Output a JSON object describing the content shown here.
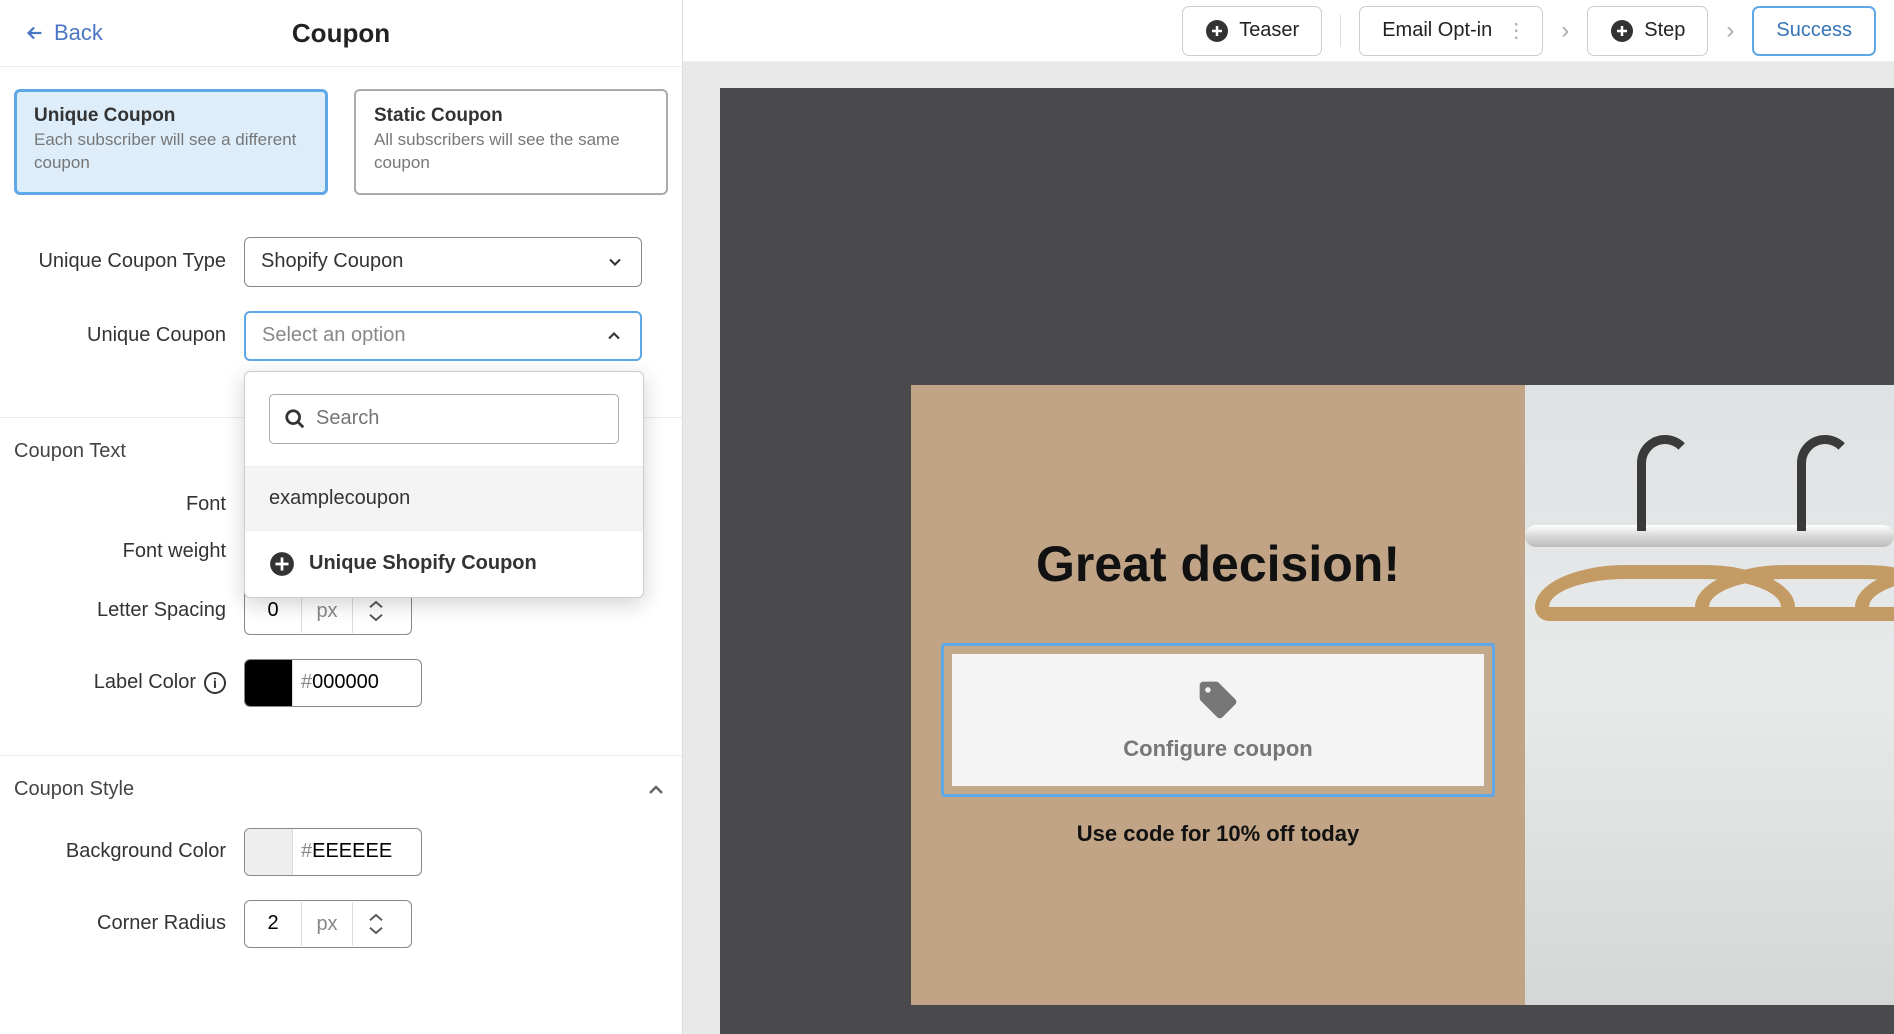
{
  "header": {
    "back": "Back",
    "title": "Coupon"
  },
  "coupon_types": {
    "unique": {
      "title": "Unique Coupon",
      "desc": "Each subscriber will see a different coupon"
    },
    "static": {
      "title": "Static Coupon",
      "desc": "All subscribers will see the same coupon"
    }
  },
  "fields": {
    "unique_type_label": "Unique Coupon Type",
    "unique_type_value": "Shopify Coupon",
    "unique_coupon_label": "Unique Coupon",
    "unique_coupon_placeholder": "Select an option"
  },
  "dropdown": {
    "search_placeholder": "Search",
    "items": [
      "examplecoupon"
    ],
    "add_label": "Unique Shopify Coupon"
  },
  "coupon_text_section": {
    "title": "Coupon Text",
    "font_label": "Font",
    "font_weight_label": "Font weight",
    "letter_spacing_label": "Letter Spacing",
    "letter_spacing_value": "0",
    "letter_spacing_unit": "px",
    "label_color_label": "Label Color",
    "label_color_value": "000000",
    "label_color_hex": "#000000"
  },
  "coupon_style_section": {
    "title": "Coupon Style",
    "bg_color_label": "Background Color",
    "bg_color_value": "EEEEEE",
    "bg_color_hex": "#EEEEEE",
    "corner_radius_label": "Corner Radius",
    "corner_radius_value": "2",
    "corner_radius_unit": "px"
  },
  "topbar": {
    "teaser": "Teaser",
    "email_optin": "Email Opt-in",
    "step": "Step",
    "success": "Success"
  },
  "preview": {
    "title": "Great decision!",
    "coupon_text": "Configure coupon",
    "sub": "Use code for 10% off today"
  }
}
